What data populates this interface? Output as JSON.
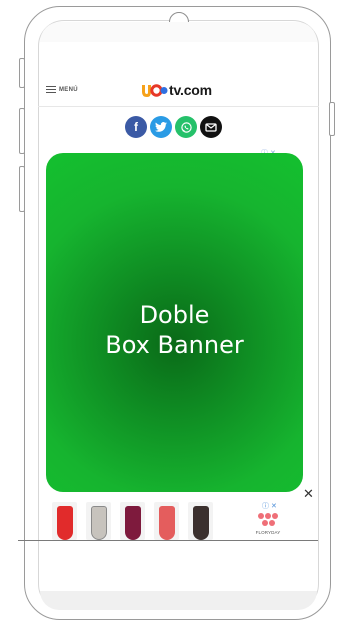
{
  "header": {
    "menu_label": "MENÚ",
    "logo_text": "tv.com"
  },
  "share": {
    "facebook_icon": "f",
    "twitter_icon": "twitter-bird",
    "whatsapp_icon": "whatsapp",
    "mail_icon": "envelope"
  },
  "ad": {
    "adchoices_top": "ⓘ ✕",
    "banner_line1": "Doble",
    "banner_line2": "Box Banner",
    "close_label": "✕",
    "adchoices_bottom": "ⓘ ✕",
    "brand_name": "FLORYDAY"
  },
  "colors": {
    "banner_green": "#14c02f",
    "facebook": "#3b5aa5",
    "twitter": "#2a9be5",
    "whatsapp": "#25c16a",
    "logo_orange": "#f6a21b",
    "logo_red": "#e73828",
    "logo_blue": "#2f6fe0"
  }
}
